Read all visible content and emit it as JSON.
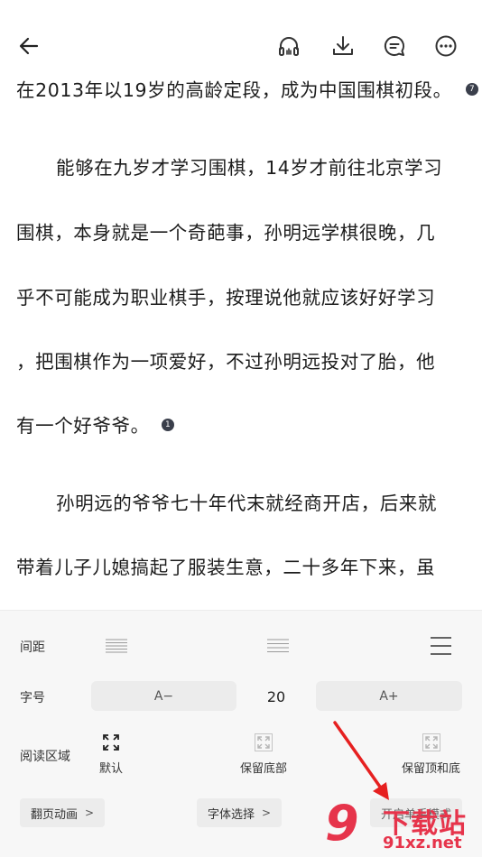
{
  "toolbar": {
    "back_icon": "arrow-left-icon",
    "listen_icon": "headphones-icon",
    "download_icon": "download-icon",
    "comment_icon": "comment-icon",
    "more_icon": "more-icon"
  },
  "reader": {
    "lines": [
      "在2013年以19岁的高龄定段，成为中国围棋初段。",
      "能够在九岁才学习围棋，14岁才前往北京学习",
      "围棋，本身就是一个奇葩事，孙明远学棋很晚，几",
      "乎不可能成为职业棋手，按理说他就应该好好学习",
      "，把围棋作为一项爱好，不过孙明远投对了胎，他",
      "有一个好爷爷。",
      "孙明远的爷爷七十年代末就经商开店，后来就",
      "带着儿子儿媳搞起了服装生意，二十多年下来，虽"
    ],
    "note_1": "7",
    "note_2": "1"
  },
  "settings": {
    "spacing_label": "间距",
    "fontsize_label": "字号",
    "font_decrease": "A−",
    "font_size": "20",
    "font_increase": "A+",
    "area_label": "阅读区域",
    "area_options": [
      "默认",
      "保留底部",
      "保留顶和底"
    ],
    "page_anim_label": "翻页动画",
    "font_select_label": "字体选择",
    "onehand_label": "开启单手模式",
    "chevron": ">"
  },
  "watermark": {
    "logo": "9",
    "text_top": "下载站",
    "text_bottom": "91xz.net"
  },
  "colors": {
    "accent_red": "#e6344b",
    "panel_bg": "#f7f7f7",
    "button_bg": "#ececec"
  }
}
